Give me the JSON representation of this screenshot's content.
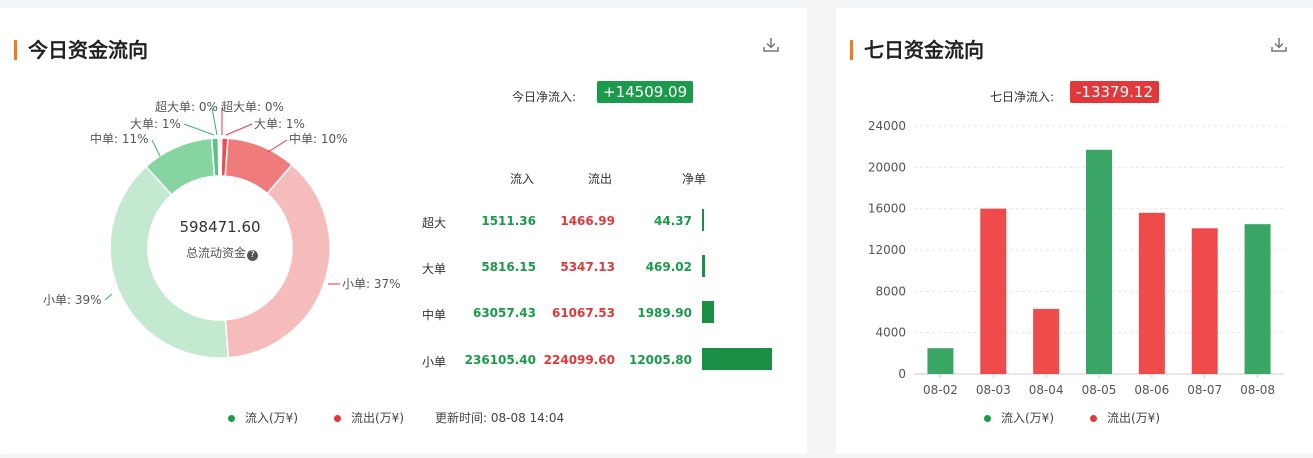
{
  "today": {
    "title": "今日资金流向",
    "net_label": "今日净流入:",
    "net_value": "+14509.09",
    "total_value": "598471.60",
    "total_label": "总流动资金",
    "donut_labels": [
      {
        "text": "超大单: 0%",
        "color": "#3ab06a"
      },
      {
        "text": "超大单: 0%",
        "color": "#e0383b"
      },
      {
        "text": "大单: 1%",
        "color": "#3ab06a"
      },
      {
        "text": "大单: 1%",
        "color": "#e0383b"
      },
      {
        "text": "中单: 11%",
        "color": "#3ab06a"
      },
      {
        "text": "中单: 10%",
        "color": "#e0383b"
      },
      {
        "text": "小单: 39%",
        "color": "#3ab06a"
      },
      {
        "text": "小单: 37%",
        "color": "#e0383b"
      }
    ],
    "table": {
      "headers": [
        "流入",
        "流出",
        "净单"
      ],
      "rows": [
        {
          "cat": "超大",
          "in": "1511.36",
          "out": "1466.99",
          "net": "44.37",
          "net_num": 44.37
        },
        {
          "cat": "大单",
          "in": "5816.15",
          "out": "5347.13",
          "net": "469.02",
          "net_num": 469.02
        },
        {
          "cat": "中单",
          "in": "63057.43",
          "out": "61067.53",
          "net": "1989.90",
          "net_num": 1989.9
        },
        {
          "cat": "小单",
          "in": "236105.40",
          "out": "224099.60",
          "net": "12005.80",
          "net_num": 12005.8
        }
      ]
    },
    "legend": {
      "inflow": "流入(万¥)",
      "outflow": "流出(万¥)",
      "updated": "更新时间: 08-08 14:04"
    }
  },
  "seven": {
    "title": "七日资金流向",
    "net_label": "七日净流入:",
    "net_value": "-13379.12",
    "legend": {
      "inflow": "流入(万¥)",
      "outflow": "流出(万¥)"
    }
  },
  "colors": {
    "inflow": "#3aa666",
    "outflow": "#ef4b4b",
    "inflow_light": "#8fd6a6",
    "outflow_light": "#f5a0a0",
    "accent": "#f07c1b"
  },
  "chart_data": [
    {
      "type": "pie",
      "categories": [
        "超大单流入",
        "大单流入",
        "中单流入",
        "小单流入",
        "小单流出",
        "中单流出",
        "大单流出",
        "超大单流出"
      ],
      "values": [
        1511.36,
        5816.15,
        63057.43,
        236105.4,
        224099.6,
        61067.53,
        5347.13,
        1466.99
      ],
      "title": "",
      "legend": [
        "流入(万¥)",
        "流出(万¥)"
      ]
    },
    {
      "type": "bar",
      "categories": [
        "08-02",
        "08-03",
        "08-04",
        "08-05",
        "08-06",
        "08-07",
        "08-08"
      ],
      "values": [
        2500,
        16000,
        6300,
        21700,
        15600,
        14100,
        14500
      ],
      "bar_types": [
        "inflow",
        "outflow",
        "outflow",
        "inflow",
        "outflow",
        "outflow",
        "inflow"
      ],
      "yticks": [
        "0",
        "4000",
        "8000",
        "12000",
        "16000",
        "20000",
        "24000"
      ],
      "ylim": [
        0,
        24000
      ],
      "grid": true,
      "legend": [
        "流入(万¥)",
        "流出(万¥)"
      ]
    }
  ]
}
